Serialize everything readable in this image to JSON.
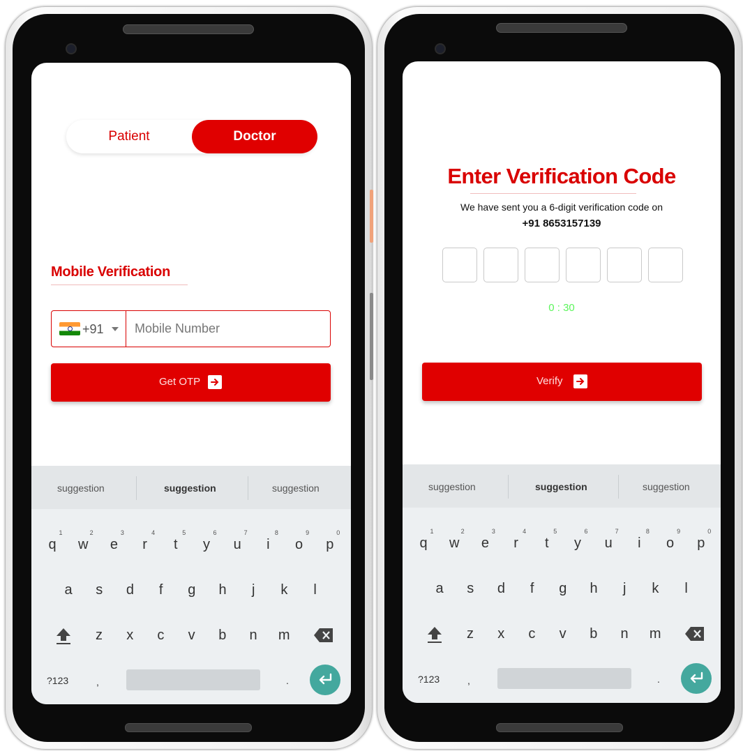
{
  "screen1": {
    "toggle": {
      "patient": "Patient",
      "doctor": "Doctor"
    },
    "section_title": "Mobile Verification",
    "country_code": "+91",
    "mobile_placeholder": "Mobile Number",
    "cta_label": "Get OTP"
  },
  "screen2": {
    "headline": "Enter Verification Code",
    "message": "We have sent you a 6-digit verification code on",
    "phone_number": "+91 8653157139",
    "otp_box_count": 6,
    "timer": "0 : 30",
    "cta_label": "Verify"
  },
  "keyboard": {
    "suggestions": [
      "suggestion",
      "suggestion",
      "suggestion"
    ],
    "row1": [
      "q",
      "w",
      "e",
      "r",
      "t",
      "y",
      "u",
      "i",
      "o",
      "p"
    ],
    "row1_hints": [
      "1",
      "2",
      "3",
      "4",
      "5",
      "6",
      "7",
      "8",
      "9",
      "0"
    ],
    "row2": [
      "a",
      "s",
      "d",
      "f",
      "g",
      "h",
      "j",
      "k",
      "l"
    ],
    "row3": [
      "z",
      "x",
      "c",
      "v",
      "b",
      "n",
      "m"
    ],
    "symbols_key": "?123",
    "comma_key": ",",
    "period_key": "."
  },
  "colors": {
    "primary_red": "#e00000",
    "timer_green": "#5cf55c",
    "enter_teal": "#44a89e",
    "side_button_orange": "#f0a27a"
  },
  "icons": [
    "arrow-right-icon",
    "shift-icon",
    "backspace-icon",
    "enter-icon",
    "india-flag-icon"
  ]
}
